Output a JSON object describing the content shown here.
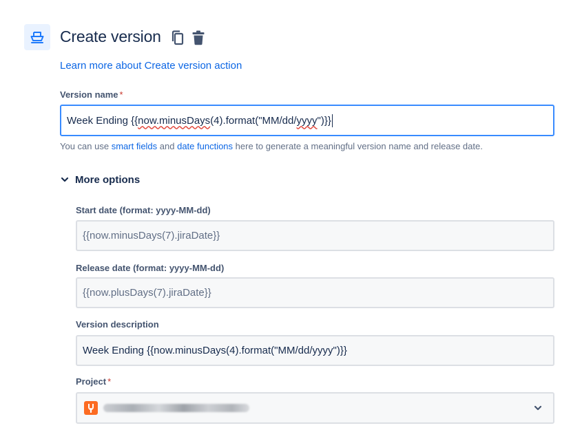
{
  "header": {
    "title": "Create version",
    "icon": "ship-icon",
    "copy_icon": "copy-icon",
    "delete_icon": "trash-icon",
    "learn_more": "Learn more about Create version action"
  },
  "colors": {
    "accent": "#0c66e4",
    "focus_border": "#388bff",
    "required": "#c9372c",
    "project_avatar": "#fc6b22"
  },
  "fields": {
    "version_name": {
      "label": "Version name",
      "required_mark": "*",
      "value": "Week Ending {{now.minusDays(4).format(\"MM/dd/yyyy\")}}",
      "value_prefix": "Week Ending {{",
      "value_underlined": "now.minusDays",
      "value_middle": "(4).format(\"MM/dd/",
      "value_underlined2": "yyyy",
      "value_suffix": "\")}}"
    },
    "helper": {
      "prefix": "You can use ",
      "smart_fields_link": "smart fields",
      "and": " and ",
      "date_functions_link": "date functions",
      "suffix": " here to generate a meaningful version name and release date."
    },
    "more_options": {
      "label": "More options",
      "expanded": true
    },
    "start_date": {
      "label": "Start date (format: yyyy-MM-dd)",
      "value": "{{now.minusDays(7).jiraDate}}"
    },
    "release_date": {
      "label": "Release date (format: yyyy-MM-dd)",
      "value": "{{now.plusDays(7).jiraDate}}"
    },
    "version_description": {
      "label": "Version description",
      "value": "Week Ending {{now.minusDays(4).format(\"MM/dd/yyyy\")}}"
    },
    "project": {
      "label": "Project",
      "required_mark": "*",
      "avatar_icon": "project-avatar-icon",
      "dropdown_icon": "chevron-down-icon"
    }
  }
}
